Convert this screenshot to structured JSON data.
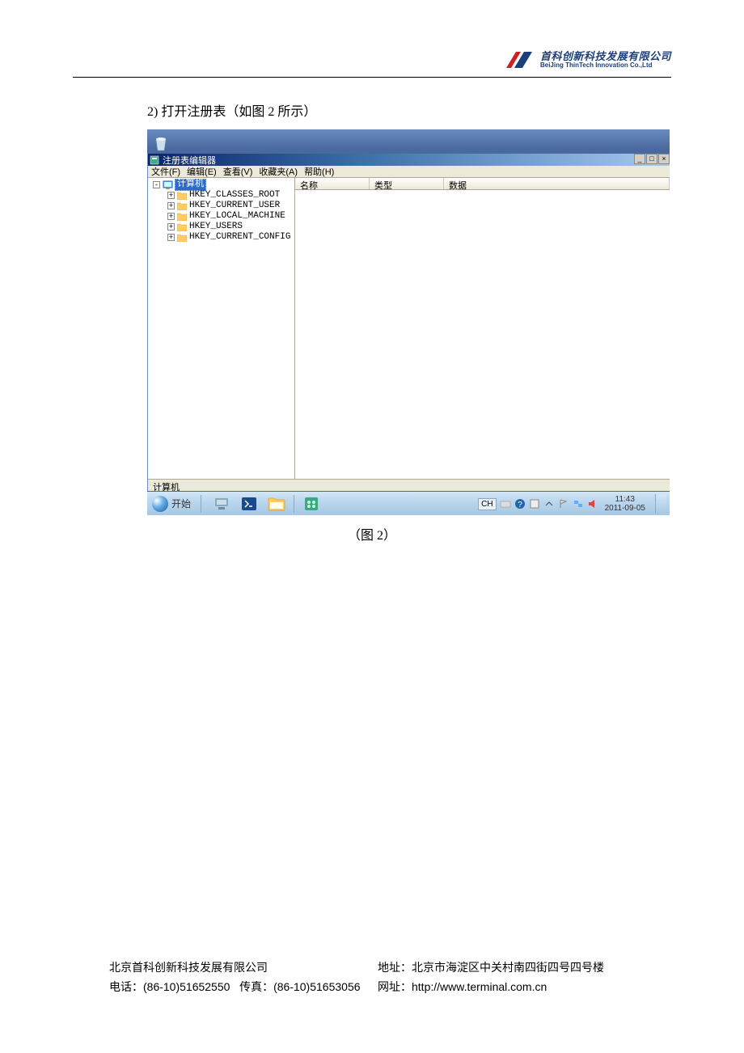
{
  "header": {
    "company_cn": "首科创新科技发展有限公司",
    "company_en": "BeiJing ThinTech Innovation Co.,Ltd"
  },
  "body": {
    "step_text": "2)  打开注册表（如图 2 所示）",
    "caption": "（图 2）"
  },
  "regedit": {
    "title": "注册表编辑器",
    "menu": {
      "file": "文件(F)",
      "edit": "编辑(E)",
      "view": "查看(V)",
      "favorites": "收藏夹(A)",
      "help": "帮助(H)"
    },
    "tree": {
      "root": "计算机",
      "keys": [
        "HKEY_CLASSES_ROOT",
        "HKEY_CURRENT_USER",
        "HKEY_LOCAL_MACHINE",
        "HKEY_USERS",
        "HKEY_CURRENT_CONFIG"
      ]
    },
    "columns": {
      "name": "名称",
      "type": "类型",
      "data": "数据"
    },
    "status": "计算机"
  },
  "taskbar": {
    "start": "开始",
    "ime": "CH",
    "clock_time": "11:43",
    "clock_date": "2011-09-05"
  },
  "footer": {
    "company": "北京首科创新科技发展有限公司",
    "address": "地址：北京市海淀区中关村南四街四号四号楼",
    "phone": "电话：(86-10)51652550",
    "fax": "传真：(86-10)51653056",
    "web": "网址：http://www.terminal.com.cn"
  }
}
